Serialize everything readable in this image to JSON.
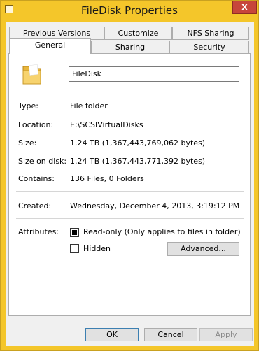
{
  "window": {
    "title": "FileDisk Properties",
    "close_label": "X"
  },
  "tabs_row1": [
    {
      "label": "Previous Versions"
    },
    {
      "label": "Customize"
    },
    {
      "label": "NFS Sharing"
    }
  ],
  "tabs_row2": [
    {
      "label": "General",
      "active": true
    },
    {
      "label": "Sharing"
    },
    {
      "label": "Security"
    }
  ],
  "general": {
    "name": "FileDisk",
    "properties": [
      {
        "label": "Type:",
        "value": "File folder"
      },
      {
        "label": "Location:",
        "value": "E:\\SCSIVirtualDisks"
      },
      {
        "label": "Size:",
        "value": "1.24 TB (1,367,443,769,062 bytes)"
      },
      {
        "label": "Size on disk:",
        "value": "1.24 TB (1,367,443,771,392 bytes)"
      },
      {
        "label": "Contains:",
        "value": "136 Files, 0 Folders"
      }
    ],
    "created": {
      "label": "Created:",
      "value": "Wednesday, December 4, 2013, 3:19:12 PM"
    },
    "attributes": {
      "label": "Attributes:",
      "readonly_label": "Read-only (Only applies to files in folder)",
      "readonly_checked": true,
      "hidden_label": "Hidden",
      "hidden_checked": false,
      "advanced_label": "Advanced..."
    }
  },
  "footer": {
    "ok": "OK",
    "cancel": "Cancel",
    "apply": "Apply"
  },
  "colors": {
    "frame": "#f4c62a",
    "close": "#c7463b",
    "panel": "#ffffff",
    "dialog": "#f0f0f0"
  }
}
